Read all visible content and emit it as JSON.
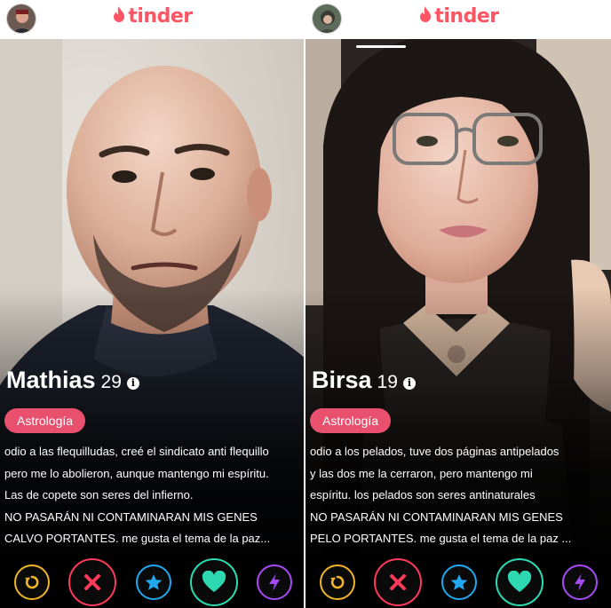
{
  "colors": {
    "brand": "#fd5564",
    "interest_tag": "#e8506e",
    "rewind": "#f0b429",
    "nope": "#fd3a5a",
    "super_like": "#22a8f0",
    "like": "#2ed8b0",
    "boost": "#a64bf4"
  },
  "profiles": [
    {
      "app_name": "tinder",
      "name": "Mathias",
      "age": "29",
      "interest": "Astrología",
      "bio_lines": [
        "odio a las flequilludas, creé el sindicato anti flequillo",
        "pero me lo abolieron, aunque mantengo mi espíritu.",
        "Las de copete son seres del infierno.",
        "NO PASARÁN NI CONTAMINARAN MIS GENES",
        "CALVO PORTANTES. me gusta el tema de la paz..."
      ],
      "actions": [
        "rewind-icon",
        "close-icon",
        "star-icon",
        "heart-icon",
        "bolt-icon"
      ]
    },
    {
      "app_name": "tinder",
      "name": "Birsa",
      "age": "19",
      "interest": "Astrología",
      "bio_lines": [
        "odio a los pelados, tuve dos páginas antipelados",
        "y las dos me la cerraron, pero mantengo mi",
        "espíritu. los pelados son seres antinaturales",
        "NO PASARÁN NI CONTAMINARAN MIS GENES",
        "PELO PORTANTES. me gusta el tema de la paz ..."
      ],
      "actions": [
        "rewind-icon",
        "close-icon",
        "star-icon",
        "heart-icon",
        "bolt-icon"
      ]
    }
  ]
}
